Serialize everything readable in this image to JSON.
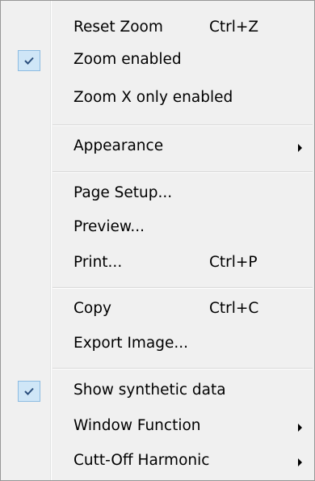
{
  "menu": {
    "items": [
      {
        "label": "Reset Zoom",
        "shortcut": "Ctrl+Z"
      },
      {
        "label": "Zoom enabled",
        "checked": true
      },
      {
        "label": "Zoom X only enabled"
      },
      {
        "label": "Appearance",
        "submenu": true
      },
      {
        "label": "Page Setup..."
      },
      {
        "label": "Preview..."
      },
      {
        "label": "Print...",
        "shortcut": "Ctrl+P"
      },
      {
        "label": "Copy",
        "shortcut": "Ctrl+C"
      },
      {
        "label": "Export Image..."
      },
      {
        "label": "Show synthetic data",
        "checked": true
      },
      {
        "label": "Window Function",
        "submenu": true
      },
      {
        "label": "Cutt-Off Harmonic",
        "submenu": true
      }
    ]
  },
  "icons": {
    "check": "checkmark-icon",
    "submenu": "submenu-arrow-icon"
  },
  "colors": {
    "menu_bg": "#f0f0f0",
    "check_bg": "#cfe6f7",
    "check_border": "#8cbbe1",
    "check_mark": "#2b4f7d"
  }
}
